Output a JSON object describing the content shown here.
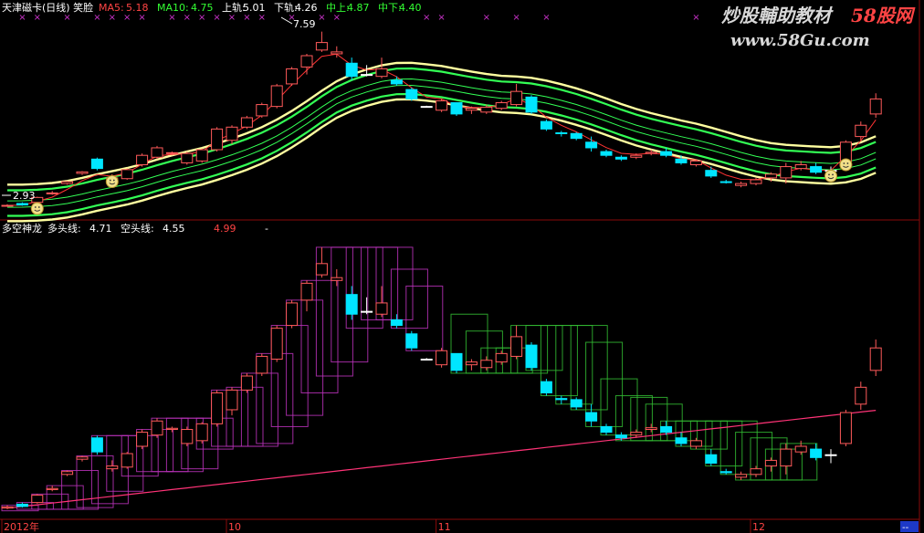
{
  "colors": {
    "background": "#000000",
    "frame": "#8a0a0a",
    "up": "#ff5a5a",
    "down": "#00e5ff",
    "flat": "#ffffff",
    "ma5": "#ff3333",
    "ma10": "#ff99aa",
    "band_edge": "#ffffa0",
    "band_inner": "#33ff55",
    "label_white": "#ffffff",
    "label_yellow": "#ffff66",
    "label_green": "#33ff33",
    "label_red": "#ff4444",
    "marker": "#cc33cc",
    "bull_box": "#bb33bb",
    "bear_box": "#33bb33",
    "long_line": "#ff3377"
  },
  "top_panel": {
    "title": "天津磁卡(日线) 笑脸",
    "indicators": [
      {
        "label": "MA5:",
        "value": "5.18",
        "color": "#ff4444"
      },
      {
        "label": "MA10:",
        "value": "4.75",
        "color": "#33ff33"
      },
      {
        "label": "上轨:",
        "value": "5.01",
        "color": "#ffffff"
      },
      {
        "label": "下轨:",
        "value": "4.26",
        "color": "#ffffff"
      },
      {
        "label": "中上:",
        "value": "4.87",
        "color": "#33ff33"
      },
      {
        "label": "中下:",
        "value": "4.40",
        "color": "#33ff33"
      }
    ],
    "high_label": "7.59",
    "low_label": "2.93"
  },
  "bottom_panel": {
    "title": "多空神龙",
    "indicators": [
      {
        "label": "多头线:",
        "value": "4.71",
        "color": "#ffffff"
      },
      {
        "label": "空头线:",
        "value": "4.55",
        "color": "#ffffff"
      },
      {
        "label": "",
        "value": "4.99",
        "color": "#ff4444"
      },
      {
        "label": "",
        "value": "-",
        "color": "#ffffff"
      }
    ]
  },
  "x_axis": {
    "labels": [
      {
        "text": "2012年",
        "index": 0
      },
      {
        "text": "10",
        "index": 15
      },
      {
        "text": "11",
        "index": 29
      },
      {
        "text": "12",
        "index": 50
      }
    ]
  },
  "watermark": {
    "line1": "炒股輔助教材",
    "line1_brand": "58股网",
    "line2": "www.58Gu.com"
  },
  "corner_label": "--",
  "chart_data": {
    "type": "candlestick",
    "note": "daily OHLC, 59 trading days",
    "y_range": [
      2.8,
      7.8
    ],
    "ohlc": [
      [
        2.95,
        3.0,
        2.93,
        2.97
      ],
      [
        3.02,
        3.05,
        2.96,
        2.98
      ],
      [
        3.05,
        3.2,
        3.03,
        3.18
      ],
      [
        3.28,
        3.35,
        3.25,
        3.3
      ],
      [
        3.55,
        3.62,
        3.52,
        3.6
      ],
      [
        3.82,
        3.88,
        3.78,
        3.86
      ],
      [
        4.2,
        4.24,
        3.9,
        3.95
      ],
      [
        3.65,
        3.8,
        3.6,
        3.7
      ],
      [
        3.68,
        3.95,
        3.65,
        3.92
      ],
      [
        4.05,
        4.35,
        4.0,
        4.3
      ],
      [
        4.25,
        4.55,
        4.2,
        4.5
      ],
      [
        4.35,
        4.4,
        4.3,
        4.37
      ],
      [
        4.1,
        4.4,
        4.05,
        4.35
      ],
      [
        4.15,
        4.48,
        4.1,
        4.45
      ],
      [
        4.45,
        5.05,
        4.4,
        5.0
      ],
      [
        4.7,
        5.1,
        4.6,
        5.05
      ],
      [
        5.05,
        5.35,
        5.0,
        5.3
      ],
      [
        5.35,
        5.7,
        5.3,
        5.65
      ],
      [
        5.6,
        6.2,
        5.55,
        6.15
      ],
      [
        6.2,
        6.65,
        6.15,
        6.6
      ],
      [
        6.65,
        7.0,
        6.45,
        6.95
      ],
      [
        7.1,
        7.59,
        7.05,
        7.3
      ],
      [
        7.0,
        7.2,
        6.9,
        7.05
      ],
      [
        6.75,
        6.9,
        6.3,
        6.4
      ],
      [
        6.45,
        6.7,
        6.4,
        6.45
      ],
      [
        6.4,
        6.9,
        6.35,
        6.6
      ],
      [
        6.3,
        6.4,
        6.15,
        6.2
      ],
      [
        6.05,
        6.1,
        5.75,
        5.8
      ],
      [
        5.6,
        5.62,
        5.58,
        5.6
      ],
      [
        5.5,
        5.8,
        5.45,
        5.75
      ],
      [
        5.7,
        5.7,
        5.35,
        5.4
      ],
      [
        5.5,
        5.6,
        5.4,
        5.55
      ],
      [
        5.45,
        5.65,
        5.4,
        5.58
      ],
      [
        5.55,
        5.75,
        5.5,
        5.7
      ],
      [
        5.65,
        6.2,
        5.6,
        6.0
      ],
      [
        5.85,
        5.9,
        5.4,
        5.45
      ],
      [
        5.2,
        5.25,
        4.95,
        5.0
      ],
      [
        4.9,
        4.95,
        4.8,
        4.88
      ],
      [
        4.88,
        4.92,
        4.7,
        4.75
      ],
      [
        4.65,
        4.8,
        4.4,
        4.5
      ],
      [
        4.4,
        4.45,
        4.25,
        4.3
      ],
      [
        4.25,
        4.3,
        4.15,
        4.2
      ],
      [
        4.25,
        4.35,
        4.2,
        4.3
      ],
      [
        4.35,
        4.45,
        4.3,
        4.38
      ],
      [
        4.4,
        4.5,
        4.25,
        4.3
      ],
      [
        4.2,
        4.3,
        4.05,
        4.1
      ],
      [
        4.05,
        4.2,
        4.0,
        4.15
      ],
      [
        3.9,
        4.0,
        3.7,
        3.75
      ],
      [
        3.6,
        3.65,
        3.55,
        3.58
      ],
      [
        3.5,
        3.6,
        3.45,
        3.55
      ],
      [
        3.55,
        3.7,
        3.5,
        3.65
      ],
      [
        3.7,
        3.85,
        3.6,
        3.8
      ],
      [
        3.7,
        4.1,
        3.55,
        4.0
      ],
      [
        3.95,
        4.15,
        3.9,
        4.05
      ],
      [
        4.0,
        4.1,
        3.8,
        3.85
      ],
      [
        3.9,
        4.0,
        3.75,
        3.9
      ],
      [
        4.1,
        4.7,
        4.05,
        4.65
      ],
      [
        4.8,
        5.2,
        4.7,
        5.1
      ],
      [
        5.4,
        5.95,
        5.3,
        5.8
      ]
    ]
  }
}
